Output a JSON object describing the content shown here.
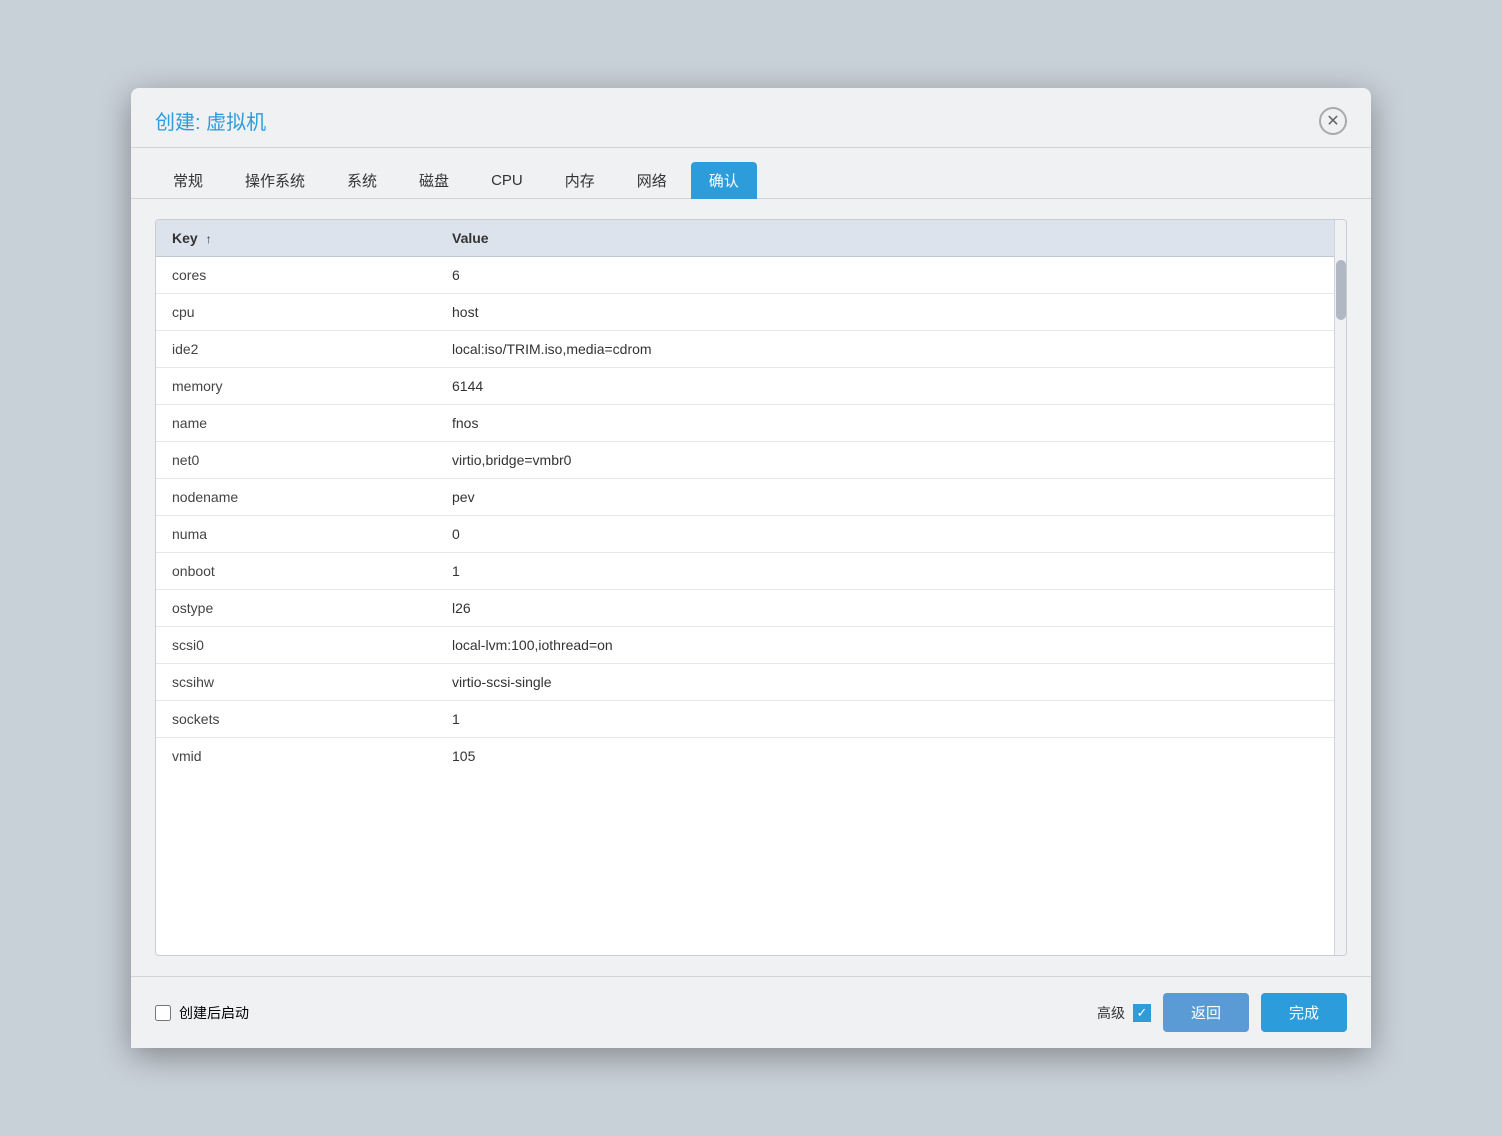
{
  "dialog": {
    "title": "创建: 虚拟机"
  },
  "tabs": [
    {
      "id": "general",
      "label": "常规",
      "active": false
    },
    {
      "id": "os",
      "label": "操作系统",
      "active": false
    },
    {
      "id": "system",
      "label": "系统",
      "active": false
    },
    {
      "id": "disk",
      "label": "磁盘",
      "active": false
    },
    {
      "id": "cpu",
      "label": "CPU",
      "active": false
    },
    {
      "id": "memory",
      "label": "内存",
      "active": false
    },
    {
      "id": "network",
      "label": "网络",
      "active": false
    },
    {
      "id": "confirm",
      "label": "确认",
      "active": true
    }
  ],
  "table": {
    "columns": [
      {
        "label": "Key",
        "sort": "↑"
      },
      {
        "label": "Value"
      }
    ],
    "rows": [
      {
        "key": "cores",
        "value": "6"
      },
      {
        "key": "cpu",
        "value": "host"
      },
      {
        "key": "ide2",
        "value": "local:iso/TRIM.iso,media=cdrom"
      },
      {
        "key": "memory",
        "value": "6144"
      },
      {
        "key": "name",
        "value": "fnos"
      },
      {
        "key": "net0",
        "value": "virtio,bridge=vmbr0"
      },
      {
        "key": "nodename",
        "value": "pev"
      },
      {
        "key": "numa",
        "value": "0"
      },
      {
        "key": "onboot",
        "value": "1"
      },
      {
        "key": "ostype",
        "value": "l26"
      },
      {
        "key": "scsi0",
        "value": "local-lvm:100,iothread=on"
      },
      {
        "key": "scsihw",
        "value": "virtio-scsi-single"
      },
      {
        "key": "sockets",
        "value": "1"
      },
      {
        "key": "vmid",
        "value": "105"
      }
    ]
  },
  "footer": {
    "start_after_create_label": "创建后启动",
    "advanced_label": "高级",
    "back_label": "返回",
    "complete_label": "完成"
  }
}
